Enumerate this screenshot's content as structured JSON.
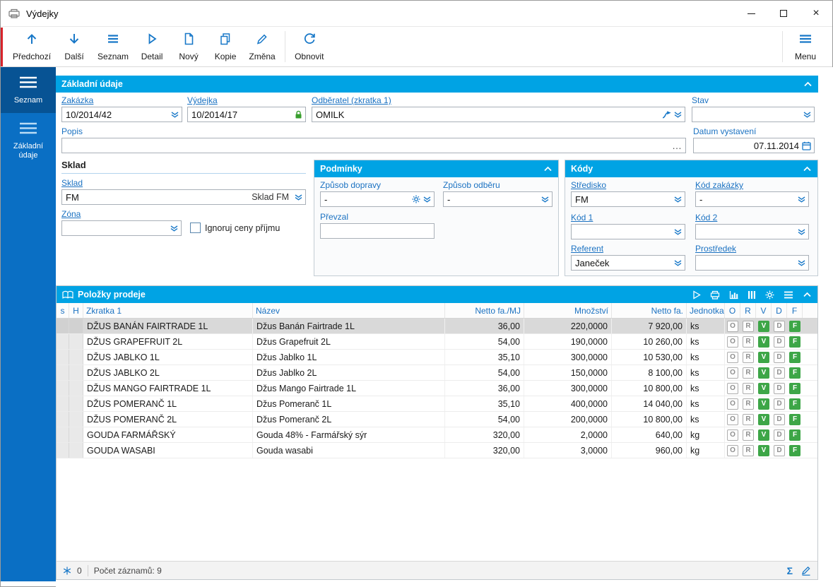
{
  "window": {
    "title": "Výdejky"
  },
  "toolbar": {
    "buttons": [
      {
        "label": "Předchozí"
      },
      {
        "label": "Další"
      },
      {
        "label": "Seznam"
      },
      {
        "label": "Detail"
      },
      {
        "label": "Nový"
      },
      {
        "label": "Kopie"
      },
      {
        "label": "Změna"
      },
      {
        "label": "Obnovit"
      }
    ],
    "menu": {
      "label": "Menu"
    }
  },
  "sidebar": {
    "items": [
      {
        "label": "Seznam"
      },
      {
        "label": "Základní údaje"
      }
    ]
  },
  "form": {
    "section_title": "Základní údaje",
    "zakazka": {
      "label": "Zakázka",
      "value": "10/2014/42"
    },
    "vydejka": {
      "label": "Výdejka",
      "value": "10/2014/17"
    },
    "odberatel": {
      "label": "Odběratel (zkratka 1)",
      "value": "OMILK"
    },
    "stav": {
      "label": "Stav",
      "value": ""
    },
    "popis": {
      "label": "Popis",
      "value": ""
    },
    "datum": {
      "label": "Datum vystavení",
      "value": "07.11.2014"
    },
    "sklad_group": {
      "title": "Sklad",
      "sklad": {
        "label": "Sklad",
        "value": "FM",
        "desc": "Sklad FM"
      },
      "zona": {
        "label": "Zóna",
        "value": ""
      },
      "checkbox": {
        "label": "Ignoruj ceny příjmu",
        "checked": false
      }
    },
    "podminky": {
      "title": "Podmínky",
      "doprava": {
        "label": "Způsob dopravy",
        "value": "-"
      },
      "odber": {
        "label": "Způsob odběru",
        "value": "-"
      },
      "prevzal": {
        "label": "Převzal",
        "value": ""
      }
    },
    "kody": {
      "title": "Kódy",
      "stredisko": {
        "label": "Středisko",
        "value": "FM"
      },
      "kod_zakazky": {
        "label": "Kód zakázky",
        "value": "-"
      },
      "kod1": {
        "label": "Kód 1",
        "value": ""
      },
      "kod2": {
        "label": "Kód 2",
        "value": ""
      },
      "referent": {
        "label": "Referent",
        "value": "Janeček"
      },
      "prostredek": {
        "label": "Prostředek",
        "value": ""
      }
    }
  },
  "table": {
    "title": "Položky prodeje",
    "columns": [
      "s",
      "H",
      "Zkratka 1",
      "Název",
      "Netto fa./MJ",
      "Množství",
      "Netto fa.",
      "Jednotka",
      "O",
      "R",
      "V",
      "D",
      "F"
    ],
    "flags": [
      {
        "letter": "O",
        "variant": "outline"
      },
      {
        "letter": "R",
        "variant": "outline"
      },
      {
        "letter": "V",
        "variant": "filled"
      },
      {
        "letter": "D",
        "variant": "outline"
      },
      {
        "letter": "F",
        "variant": "filled"
      }
    ],
    "rows": [
      {
        "zkratka": "DŽUS BANÁN FAIRTRADE 1L",
        "nazev": "Džus Banán Fairtrade 1L",
        "netto_mj": "36,00",
        "mnozstvi": "220,0000",
        "netto": "7 920,00",
        "jednotka": "ks"
      },
      {
        "zkratka": "DŽUS GRAPEFRUIT 2L",
        "nazev": "Džus Grapefruit 2L",
        "netto_mj": "54,00",
        "mnozstvi": "190,0000",
        "netto": "10 260,00",
        "jednotka": "ks"
      },
      {
        "zkratka": "DŽUS JABLKO 1L",
        "nazev": "Džus Jablko 1L",
        "netto_mj": "35,10",
        "mnozstvi": "300,0000",
        "netto": "10 530,00",
        "jednotka": "ks"
      },
      {
        "zkratka": "DŽUS JABLKO 2L",
        "nazev": "Džus Jablko 2L",
        "netto_mj": "54,00",
        "mnozstvi": "150,0000",
        "netto": "8 100,00",
        "jednotka": "ks"
      },
      {
        "zkratka": "DŽUS MANGO FAIRTRADE 1L",
        "nazev": "Džus Mango Fairtrade 1L",
        "netto_mj": "36,00",
        "mnozstvi": "300,0000",
        "netto": "10 800,00",
        "jednotka": "ks"
      },
      {
        "zkratka": "DŽUS POMERANČ 1L",
        "nazev": "Džus Pomeranč 1L",
        "netto_mj": "35,10",
        "mnozstvi": "400,0000",
        "netto": "14 040,00",
        "jednotka": "ks"
      },
      {
        "zkratka": "DŽUS POMERANČ 2L",
        "nazev": "Džus Pomeranč 2L",
        "netto_mj": "54,00",
        "mnozstvi": "200,0000",
        "netto": "10 800,00",
        "jednotka": "ks"
      },
      {
        "zkratka": "GOUDA FARMÁŘSKÝ",
        "nazev": "Gouda 48% - Farmářský sýr",
        "netto_mj": "320,00",
        "mnozstvi": "2,0000",
        "netto": "640,00",
        "jednotka": "kg"
      },
      {
        "zkratka": "GOUDA WASABI",
        "nazev": "Gouda wasabi",
        "netto_mj": "320,00",
        "mnozstvi": "3,0000",
        "netto": "960,00",
        "jednotka": "kg"
      }
    ],
    "status": {
      "frozen": "0",
      "records": "Počet záznamů: 9"
    }
  }
}
